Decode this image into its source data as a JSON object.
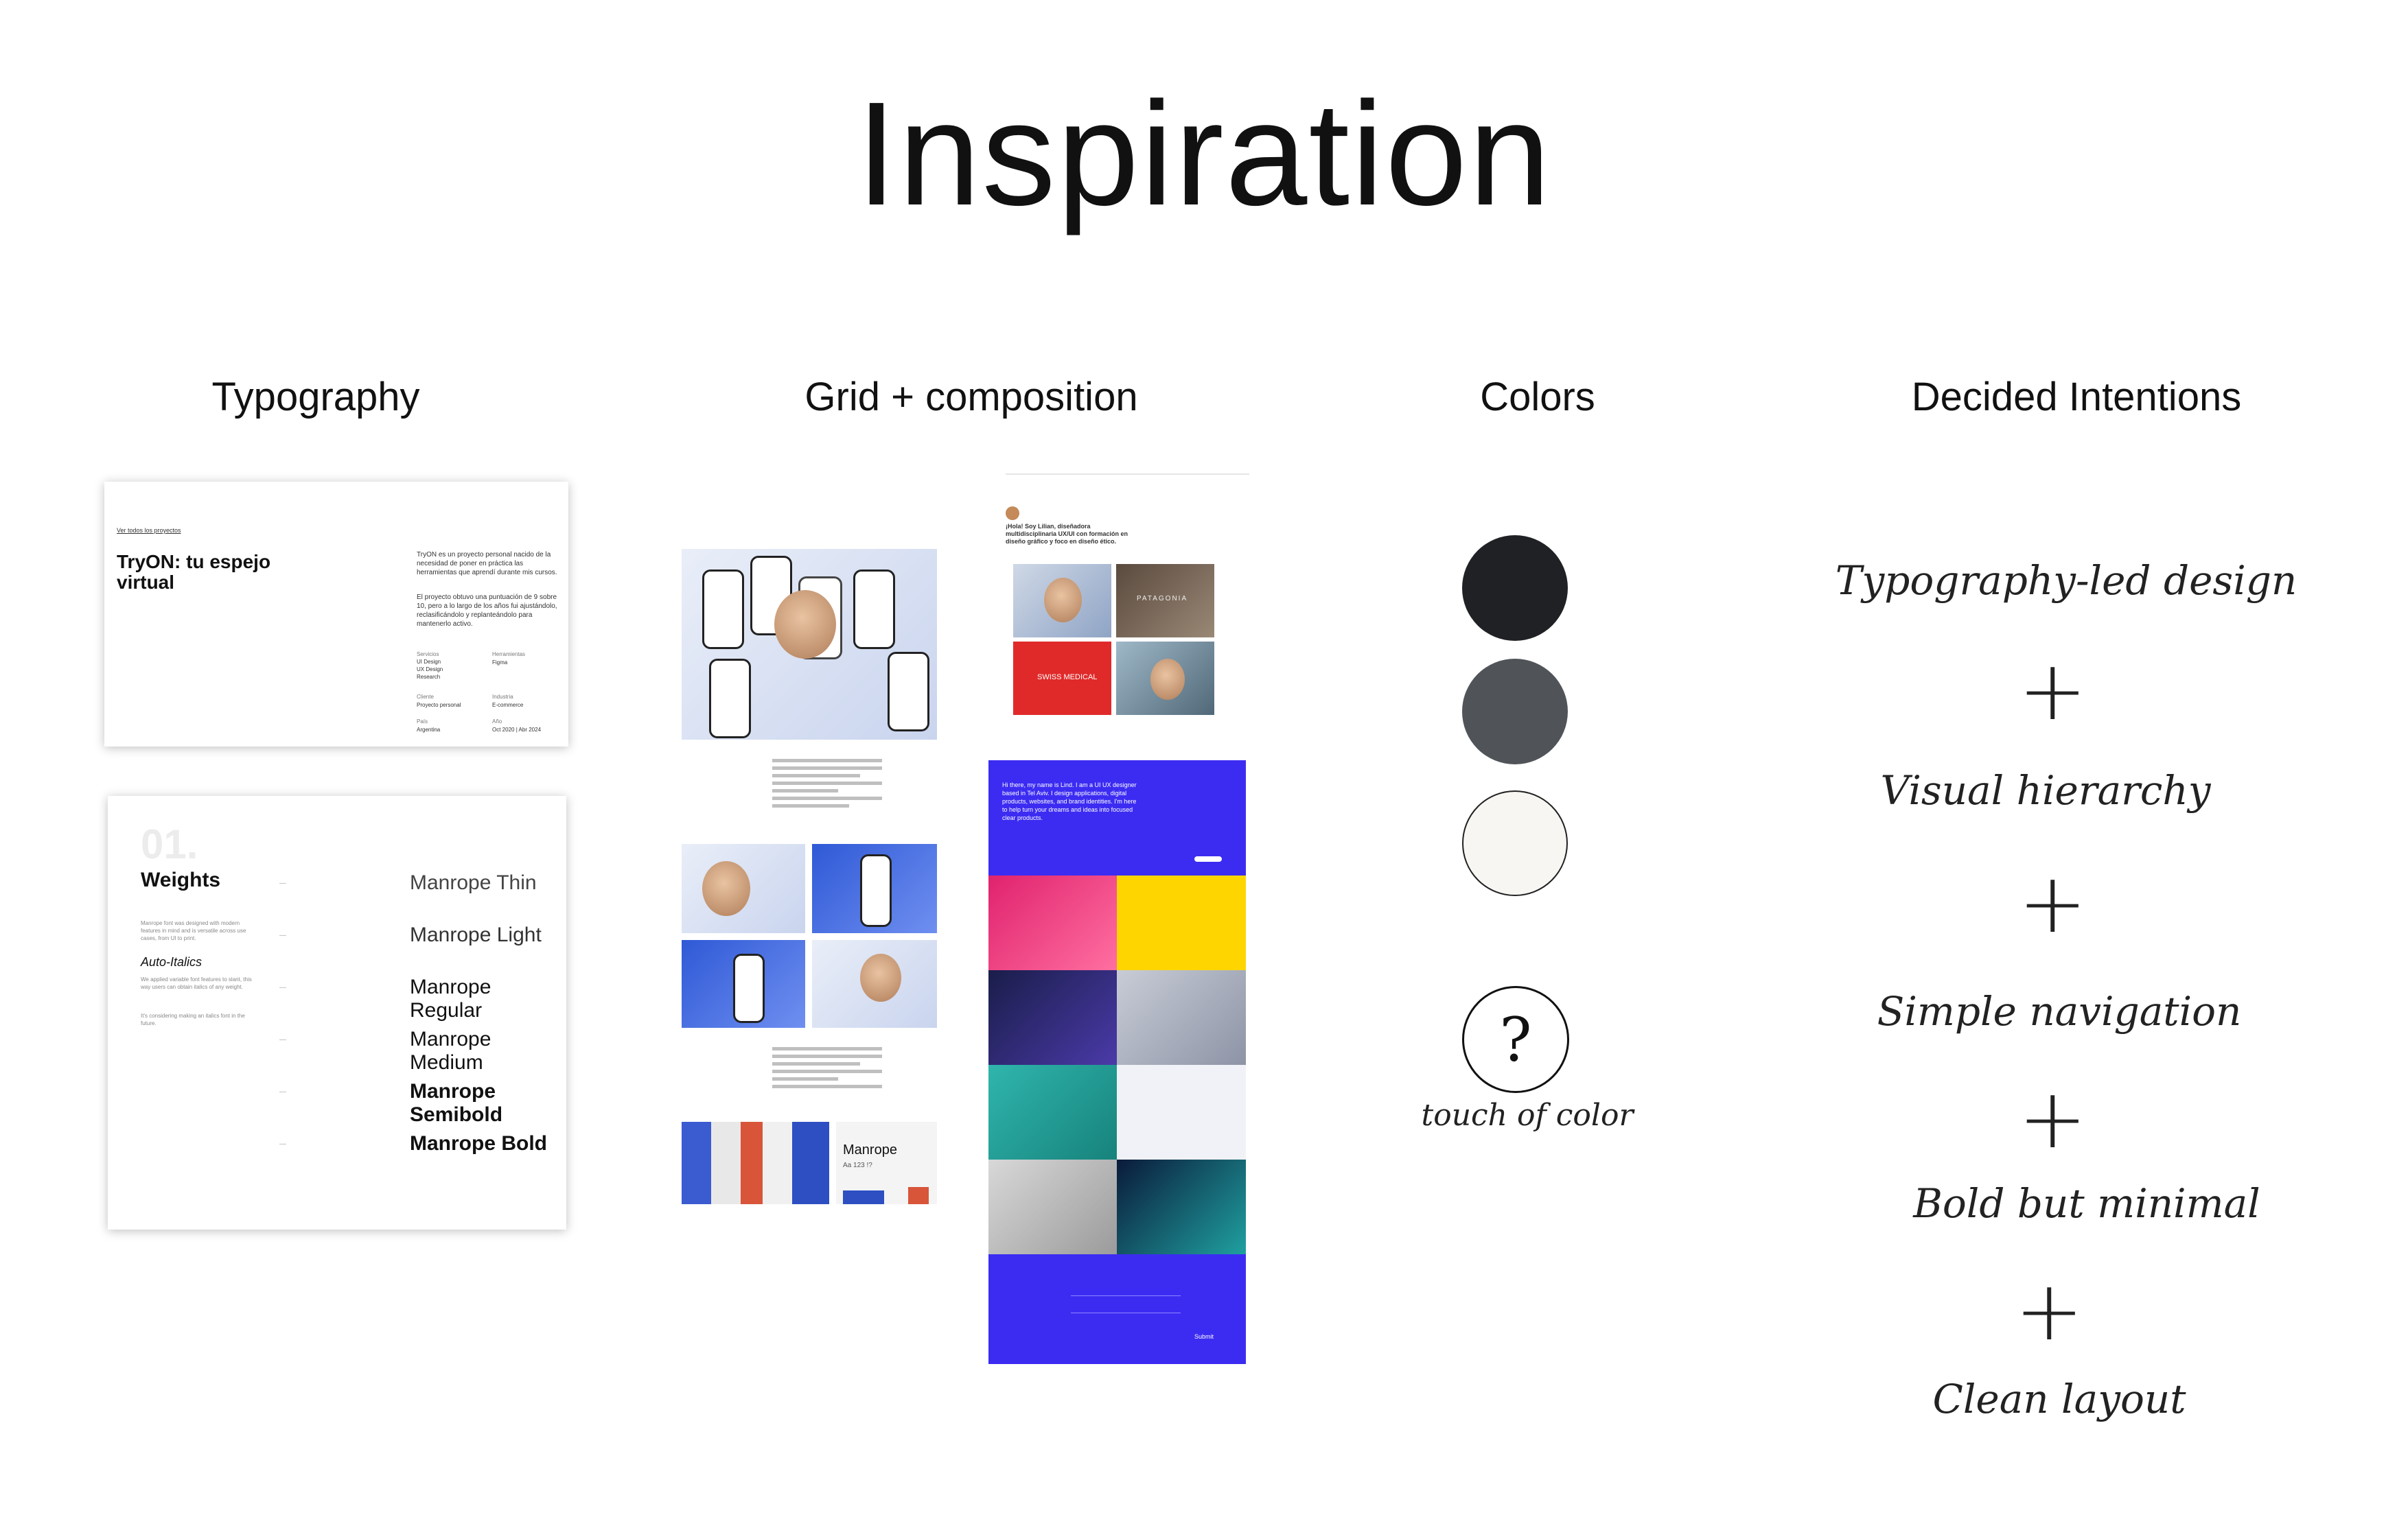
{
  "title": "Inspiration",
  "columns": {
    "typography": "Typography",
    "grid": "Grid + composition",
    "colors": "Colors",
    "intentions": "Decided Intentions"
  },
  "typo_card1": {
    "kicker": "Ver todos los proyectos",
    "heading": "TryON: tu espejo virtual",
    "para1": "TryON es un proyecto personal nacido de la necesidad de poner en práctica las herramientas que aprendí durante mis cursos.",
    "para2": "El proyecto obtuvo una puntuación de 9 sobre 10, pero a lo largo de los años fui ajustándolo, reclasificándolo y replanteándolo para mantenerlo activo.",
    "meta": [
      {
        "k": "Servicios",
        "v": "UI Design\nUX Design\nResearch"
      },
      {
        "k": "Herramientas",
        "v": "Figma"
      },
      {
        "k": "Cliente",
        "v": "Proyecto personal"
      },
      {
        "k": "Industria",
        "v": "E-commerce"
      },
      {
        "k": "País",
        "v": "Argentina"
      },
      {
        "k": "Año",
        "v": "Oct 2020 | Abr 2024"
      }
    ]
  },
  "typo_card2": {
    "number": "01.",
    "heading": "Weights",
    "desc": "Manrope font was designed with modern features in mind and is versatile across use cases, from UI to print.",
    "italic_label": "Auto-Italics",
    "italic_desc": "We applied variable font features to slant, this way users can obtain italics of any weight.",
    "extra": "It's considering making an italics font in the future.",
    "weights": [
      "Manrope Thin",
      "Manrope Light",
      "Manrope Regular",
      "Manrope Medium",
      "Manrope Semibold",
      "Manrope Bold"
    ]
  },
  "grid_right": {
    "intro": "¡Hola! Soy Lilian, diseñadora multidisciplinaria UX/UI con formación en diseño gráfico y foco en diseño ético.",
    "tile_red_text": "SWISS MEDICAL",
    "tile_brand_text": "PATAGONIA",
    "blue_intro": "Hi there, my name is Lind. I am a UI UX designer based in Tel Aviv. I design applications, digital products, websites, and brand identities. I'm here to help turn your dreams and ideas into focused clear products.",
    "submit": "Submit"
  },
  "grid_left": {
    "font_card": "Manrope",
    "font_card_sub": "Aa 123 !?"
  },
  "colors": {
    "swatches": [
      "#1f2125",
      "#505458",
      "#f7f6f2"
    ],
    "question": "?",
    "touch_label": "touch of color"
  },
  "intentions": [
    "Typography-led design",
    "Visual hierarchy",
    "Simple navigation",
    "Bold but minimal",
    "Clean layout"
  ],
  "plus": "+"
}
